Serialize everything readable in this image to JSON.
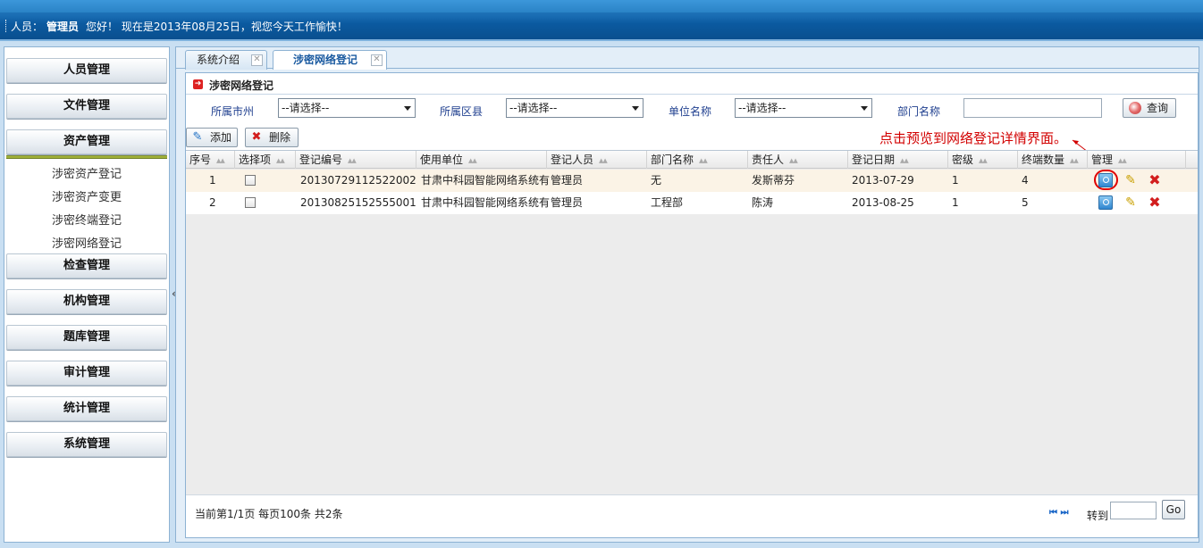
{
  "header": {
    "user_prefix": "人员：",
    "user_name": "管理员",
    "greeting": "您好！ 现在是2013年08月25日，视您今天工作愉快！"
  },
  "sidebar": {
    "menus": [
      {
        "label": "人员管理"
      },
      {
        "label": "文件管理"
      },
      {
        "label": "资产管理"
      },
      {
        "label": "检查管理"
      },
      {
        "label": "机构管理"
      },
      {
        "label": "题库管理"
      },
      {
        "label": "审计管理"
      },
      {
        "label": "统计管理"
      },
      {
        "label": "系统管理"
      }
    ],
    "submenu": [
      "涉密资产登记",
      "涉密资产变更",
      "涉密终端登记",
      "涉密网络登记"
    ],
    "collapse_glyph": "«"
  },
  "tabs": [
    {
      "label": "系统介绍"
    },
    {
      "label": "涉密网络登记"
    }
  ],
  "section": {
    "title": "涉密网络登记"
  },
  "filters": {
    "city_label": "所属市州",
    "county_label": "所属区县",
    "unit_label": "单位名称",
    "dept_label": "部门名称",
    "select_placeholder": "--请选择--",
    "query_label": "查询"
  },
  "toolbar": {
    "add_label": "添加",
    "delete_label": "删除"
  },
  "annotation": "点击预览到网络登记详情界面。",
  "table": {
    "columns": [
      "序号",
      "选择项",
      "登记编号",
      "使用单位",
      "登记人员",
      "部门名称",
      "责任人",
      "登记日期",
      "密级",
      "终端数量",
      "管理"
    ],
    "rows": [
      {
        "index": "1",
        "reg_no": "20130729112522002",
        "unit": "甘肃中科园智能网络系统有",
        "registrar": "管理员",
        "dept": "无",
        "owner": "发斯蒂芬",
        "date": "2013-07-29",
        "level": "1",
        "terminals": "4"
      },
      {
        "index": "2",
        "reg_no": "20130825152555001",
        "unit": "甘肃中科园智能网络系统有",
        "registrar": "管理员",
        "dept": "工程部",
        "owner": "陈涛",
        "date": "2013-08-25",
        "level": "1",
        "terminals": "5"
      }
    ]
  },
  "pager": {
    "info": "当前第1/1页  每页100条  共2条",
    "first": "⏮",
    "last": "⏭",
    "goto_label": "转到",
    "go_label": "Go"
  },
  "colors": {
    "accent": "#0b5aa0",
    "annotation": "#d20000",
    "highlight_row": "#fbf3e6"
  }
}
